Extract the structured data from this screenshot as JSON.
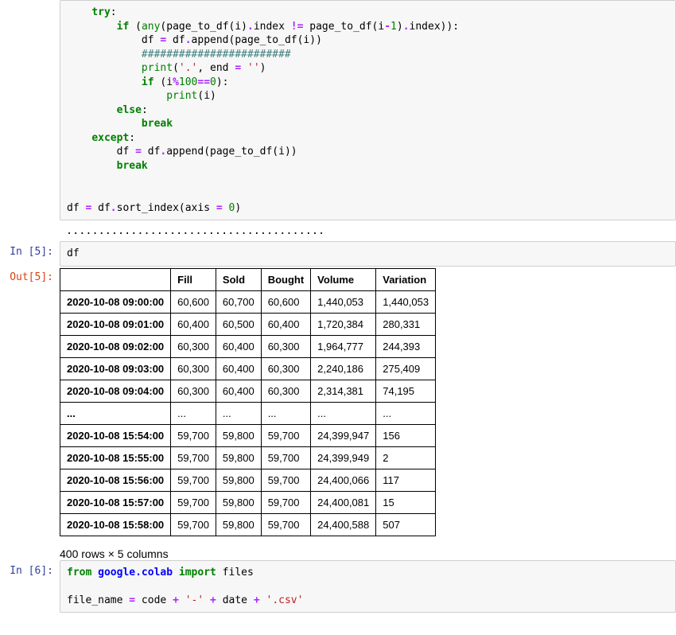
{
  "cells": {
    "code_top_prompt": "",
    "code_top": {
      "tokens": [
        {
          "t": "    ",
          "c": ""
        },
        {
          "t": "try",
          "c": "kw"
        },
        {
          "t": ":\n",
          "c": ""
        },
        {
          "t": "        ",
          "c": ""
        },
        {
          "t": "if",
          "c": "kw"
        },
        {
          "t": " (",
          "c": ""
        },
        {
          "t": "any",
          "c": "builtin"
        },
        {
          "t": "(page_to_df(i)",
          "c": ""
        },
        {
          "t": ".",
          "c": "op"
        },
        {
          "t": "index ",
          "c": ""
        },
        {
          "t": "!=",
          "c": "op"
        },
        {
          "t": " page_to_df(i",
          "c": ""
        },
        {
          "t": "-",
          "c": "op"
        },
        {
          "t": "1",
          "c": "num"
        },
        {
          "t": ")",
          "c": ""
        },
        {
          "t": ".",
          "c": "op"
        },
        {
          "t": "index)):\n",
          "c": ""
        },
        {
          "t": "            df ",
          "c": ""
        },
        {
          "t": "=",
          "c": "op"
        },
        {
          "t": " df",
          "c": ""
        },
        {
          "t": ".",
          "c": "op"
        },
        {
          "t": "append(page_to_df(i))\n",
          "c": ""
        },
        {
          "t": "            ",
          "c": ""
        },
        {
          "t": "########################",
          "c": "cmt"
        },
        {
          "t": "\n",
          "c": ""
        },
        {
          "t": "            ",
          "c": ""
        },
        {
          "t": "print",
          "c": "builtin"
        },
        {
          "t": "(",
          "c": ""
        },
        {
          "t": "'.'",
          "c": "str"
        },
        {
          "t": ", end ",
          "c": ""
        },
        {
          "t": "=",
          "c": "op"
        },
        {
          "t": " ",
          "c": ""
        },
        {
          "t": "''",
          "c": "str"
        },
        {
          "t": ")\n",
          "c": ""
        },
        {
          "t": "            ",
          "c": ""
        },
        {
          "t": "if",
          "c": "kw"
        },
        {
          "t": " (i",
          "c": ""
        },
        {
          "t": "%",
          "c": "op"
        },
        {
          "t": "100",
          "c": "num"
        },
        {
          "t": "==",
          "c": "op"
        },
        {
          "t": "0",
          "c": "num"
        },
        {
          "t": "):\n",
          "c": ""
        },
        {
          "t": "                ",
          "c": ""
        },
        {
          "t": "print",
          "c": "builtin"
        },
        {
          "t": "(i)\n",
          "c": ""
        },
        {
          "t": "        ",
          "c": ""
        },
        {
          "t": "else",
          "c": "kw"
        },
        {
          "t": ":\n",
          "c": ""
        },
        {
          "t": "            ",
          "c": ""
        },
        {
          "t": "break",
          "c": "kw"
        },
        {
          "t": "\n",
          "c": ""
        },
        {
          "t": "    ",
          "c": ""
        },
        {
          "t": "except",
          "c": "kw"
        },
        {
          "t": ":\n",
          "c": ""
        },
        {
          "t": "        df ",
          "c": ""
        },
        {
          "t": "=",
          "c": "op"
        },
        {
          "t": " df",
          "c": ""
        },
        {
          "t": ".",
          "c": "op"
        },
        {
          "t": "append(page_to_df(i))\n",
          "c": ""
        },
        {
          "t": "        ",
          "c": ""
        },
        {
          "t": "break",
          "c": "kw"
        },
        {
          "t": "\n",
          "c": ""
        },
        {
          "t": "\n",
          "c": ""
        },
        {
          "t": "\n",
          "c": ""
        },
        {
          "t": "df ",
          "c": ""
        },
        {
          "t": "=",
          "c": "op"
        },
        {
          "t": " df",
          "c": ""
        },
        {
          "t": ".",
          "c": "op"
        },
        {
          "t": "sort_index(axis ",
          "c": ""
        },
        {
          "t": "=",
          "c": "op"
        },
        {
          "t": " ",
          "c": ""
        },
        {
          "t": "0",
          "c": "num"
        },
        {
          "t": ")",
          "c": ""
        }
      ]
    },
    "dots_output": "........................................",
    "in5_prompt": "In [5]:",
    "in5_code": "df",
    "out5_prompt": "Out[5]:",
    "table": {
      "columns": [
        "",
        "Fill",
        "Sold",
        "Bought",
        "Volume",
        "Variation"
      ],
      "rows": [
        [
          "2020-10-08 09:00:00",
          "60,600",
          "60,700",
          "60,600",
          "1,440,053",
          "1,440,053"
        ],
        [
          "2020-10-08 09:01:00",
          "60,400",
          "60,500",
          "60,400",
          "1,720,384",
          "280,331"
        ],
        [
          "2020-10-08 09:02:00",
          "60,300",
          "60,400",
          "60,300",
          "1,964,777",
          "244,393"
        ],
        [
          "2020-10-08 09:03:00",
          "60,300",
          "60,400",
          "60,300",
          "2,240,186",
          "275,409"
        ],
        [
          "2020-10-08 09:04:00",
          "60,300",
          "60,400",
          "60,300",
          "2,314,381",
          "74,195"
        ],
        [
          "...",
          "...",
          "...",
          "...",
          "...",
          "..."
        ],
        [
          "2020-10-08 15:54:00",
          "59,700",
          "59,800",
          "59,700",
          "24,399,947",
          "156"
        ],
        [
          "2020-10-08 15:55:00",
          "59,700",
          "59,800",
          "59,700",
          "24,399,949",
          "2"
        ],
        [
          "2020-10-08 15:56:00",
          "59,700",
          "59,800",
          "59,700",
          "24,400,066",
          "117"
        ],
        [
          "2020-10-08 15:57:00",
          "59,700",
          "59,800",
          "59,700",
          "24,400,081",
          "15"
        ],
        [
          "2020-10-08 15:58:00",
          "59,700",
          "59,800",
          "59,700",
          "24,400,588",
          "507"
        ]
      ],
      "caption": "400 rows × 5 columns"
    },
    "in6_prompt": "In [6]:",
    "code6": {
      "tokens": [
        {
          "t": "from",
          "c": "kw"
        },
        {
          "t": " ",
          "c": ""
        },
        {
          "t": "google.colab",
          "c": "mod"
        },
        {
          "t": " ",
          "c": ""
        },
        {
          "t": "import",
          "c": "kw"
        },
        {
          "t": " files\n",
          "c": ""
        },
        {
          "t": "\n",
          "c": ""
        },
        {
          "t": "file_name ",
          "c": ""
        },
        {
          "t": "=",
          "c": "op"
        },
        {
          "t": " code ",
          "c": ""
        },
        {
          "t": "+",
          "c": "op"
        },
        {
          "t": " ",
          "c": ""
        },
        {
          "t": "'-'",
          "c": "str"
        },
        {
          "t": " ",
          "c": ""
        },
        {
          "t": "+",
          "c": "op"
        },
        {
          "t": " date ",
          "c": ""
        },
        {
          "t": "+",
          "c": "op"
        },
        {
          "t": " ",
          "c": ""
        },
        {
          "t": "'.csv'",
          "c": "str"
        }
      ]
    }
  }
}
